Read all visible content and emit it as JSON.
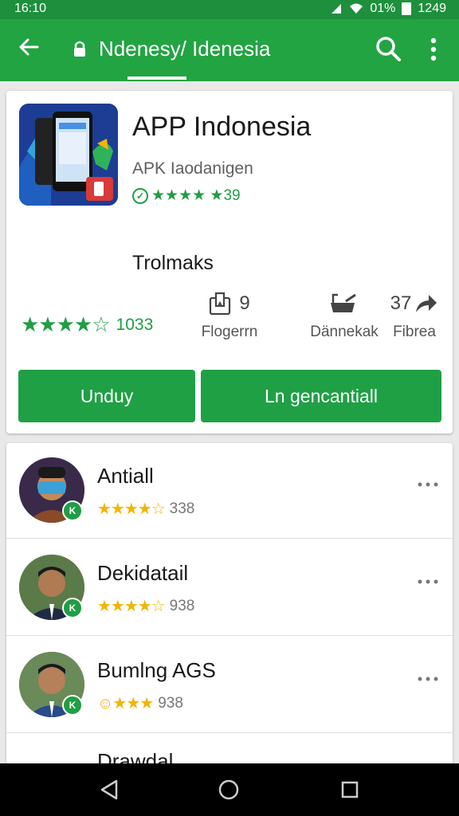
{
  "status_bar": {
    "time": "16:10",
    "battery_text": "01%",
    "clock_right": "1249"
  },
  "app_bar": {
    "title": "Ndenesy/ Idenesia"
  },
  "app": {
    "name": "APP Indonesia",
    "developer": "APK Iaodanigen",
    "badge_text": "★★★★ ★39",
    "section_title": "Trolmaks",
    "rating_value": "1033",
    "stats": [
      {
        "icon": "bookmark-icon",
        "icon_text": "9",
        "label": "Flogerrn"
      },
      {
        "icon": "bath-icon",
        "icon_text": "",
        "label": "Dännekak"
      },
      {
        "icon": "share-icon",
        "icon_text": "37",
        "label": "Fibrea"
      }
    ],
    "install_label": "Unduy",
    "open_label": "Ln gencantiall"
  },
  "reviews": [
    {
      "name": "Antiall",
      "rating_text": "338",
      "stars": 3.5
    },
    {
      "name": "Dekidatail",
      "rating_text": "938",
      "stars": 3.5
    },
    {
      "name": "Bumlng AGS",
      "rating_text": "938",
      "stars": 4
    }
  ],
  "partial_review_name": "Drawdal",
  "colors": {
    "status_bar": "#1e8f3c",
    "app_bar": "#22a442",
    "accent_green": "#1f9e44",
    "star_gold": "#f4b400"
  }
}
